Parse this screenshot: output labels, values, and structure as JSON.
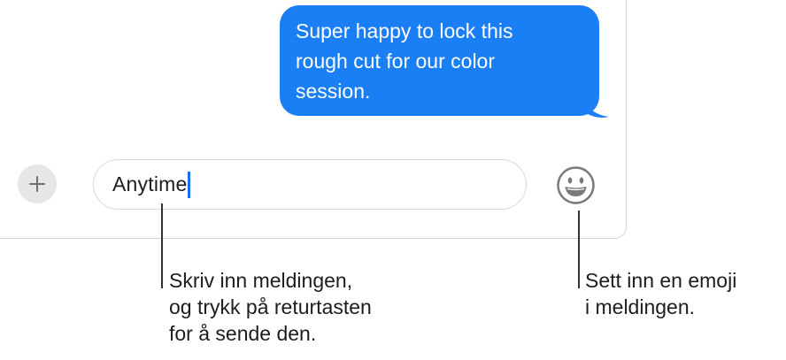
{
  "conversation": {
    "sent_message": "Super happy to lock this rough cut for our color session.",
    "sent_message_lines": [
      "Super happy to lock this",
      "rough cut for our color",
      "session."
    ]
  },
  "composer": {
    "add_button_icon": "plus-icon",
    "field_value": "Anytime",
    "emoji_button_icon": "smiley-face-icon"
  },
  "callouts": {
    "message_field": {
      "lines": [
        "Skriv inn meldingen,",
        "og trykk på returtasten",
        "for å sende den."
      ]
    },
    "emoji_button": {
      "lines": [
        "Sett inn en emoji",
        "i meldingen."
      ]
    }
  },
  "colors": {
    "bubble": "#1a7ef5",
    "caret": "#1a6ef0",
    "add_button_bg": "#e6e6e8"
  }
}
